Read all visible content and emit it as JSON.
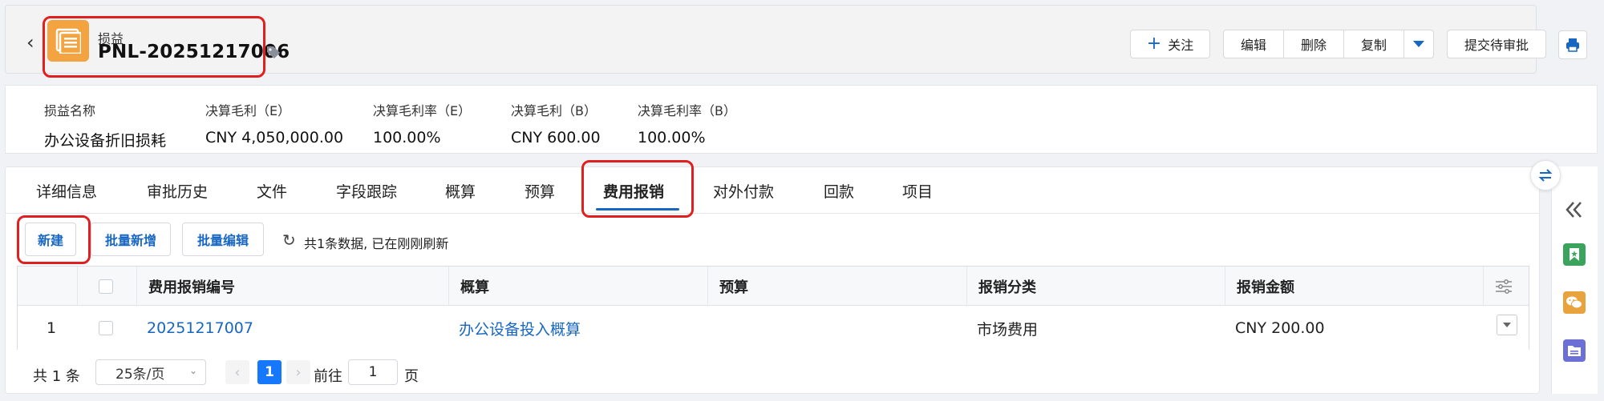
{
  "header": {
    "object_type": "损益",
    "record_code": "PNL-20251217006",
    "actions": {
      "follow": "关注",
      "edit": "编辑",
      "delete": "删除",
      "copy": "复制",
      "submit": "提交待审批"
    }
  },
  "summary": [
    {
      "label": "损益名称",
      "value": "办公设备折旧损耗"
    },
    {
      "label": "决算毛利（E）",
      "value": "CNY 4,050,000.00"
    },
    {
      "label": "决算毛利率（E）",
      "value": "100.00%"
    },
    {
      "label": "决算毛利（B）",
      "value": "CNY 600.00"
    },
    {
      "label": "决算毛利率（B）",
      "value": "100.00%"
    }
  ],
  "tabs": [
    "详细信息",
    "审批历史",
    "文件",
    "字段跟踪",
    "概算",
    "预算",
    "费用报销",
    "对外付款",
    "回款",
    "项目"
  ],
  "active_tab": "费用报销",
  "toolbar": {
    "new": "新建",
    "batch_add": "批量新增",
    "batch_edit": "批量编辑",
    "status": "共1条数据, 已在刚刚刷新"
  },
  "table": {
    "columns": [
      "费用报销编号",
      "概算",
      "预算",
      "报销分类",
      "报销金额"
    ],
    "rows": [
      {
        "index": "1",
        "code": "20251217007",
        "estimate": "办公设备投入概算",
        "budget": "",
        "category": "市场费用",
        "amount": "CNY 200.00"
      }
    ]
  },
  "pagination": {
    "total": "共 1 条",
    "page_size": "25条/页",
    "current_page": "1",
    "goto_label": "前往",
    "goto_value": "1",
    "page_suffix": "页"
  },
  "colors": {
    "accent": "#1766c2",
    "highlight": "#e02020",
    "icon_orange": "#f4a341",
    "rail_green": "#3aa35c",
    "rail_orange": "#e8a33d",
    "rail_purple": "#6b6fd6"
  },
  "icons": [
    "back-arrow-icon",
    "record-icon",
    "tag-icon",
    "plus-icon",
    "chevron-down-icon",
    "print-icon",
    "refresh-icon",
    "column-settings-icon",
    "swap-icon",
    "double-chevron-left-icon",
    "bookmark-icon",
    "wechat-icon",
    "folder-icon"
  ]
}
